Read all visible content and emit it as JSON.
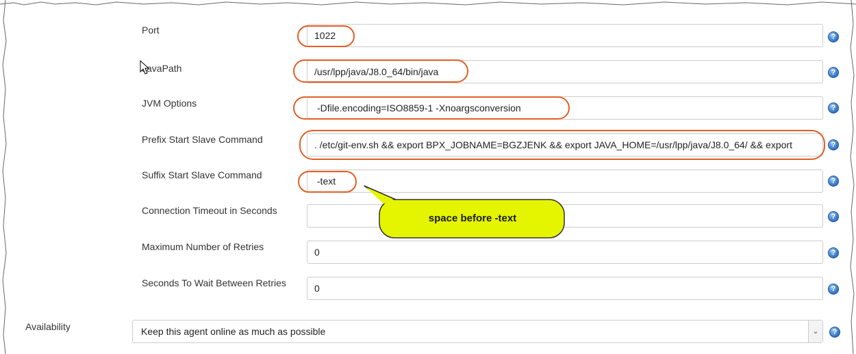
{
  "rows": [
    {
      "label": "Port",
      "value": "1022"
    },
    {
      "label": "JavaPath",
      "value": "/usr/lpp/java/J8.0_64/bin/java"
    },
    {
      "label": "JVM Options",
      "value": "-Dfile.encoding=ISO8859-1   -Xnoargsconversion"
    },
    {
      "label": "Prefix Start Slave Command",
      "value": ". /etc/git-env.sh  && export BPX_JOBNAME=BGZJENK && export JAVA_HOME=/usr/lpp/java/J8.0_64/ && export"
    },
    {
      "label": "Suffix Start Slave Command",
      "value": " -text"
    },
    {
      "label": "Connection Timeout in Seconds",
      "value": ""
    },
    {
      "label": "Maximum Number of Retries",
      "value": "0"
    },
    {
      "label": "Seconds To Wait Between Retries",
      "value": "0"
    }
  ],
  "availability": {
    "label": "Availability",
    "selected": "Keep this agent online as much as possible"
  },
  "help_glyph": "?",
  "callout": {
    "text": "space before -text",
    "color": "#e5f500"
  },
  "highlight_color": "#e35d22",
  "help_icon_color": "#2f6fc2"
}
